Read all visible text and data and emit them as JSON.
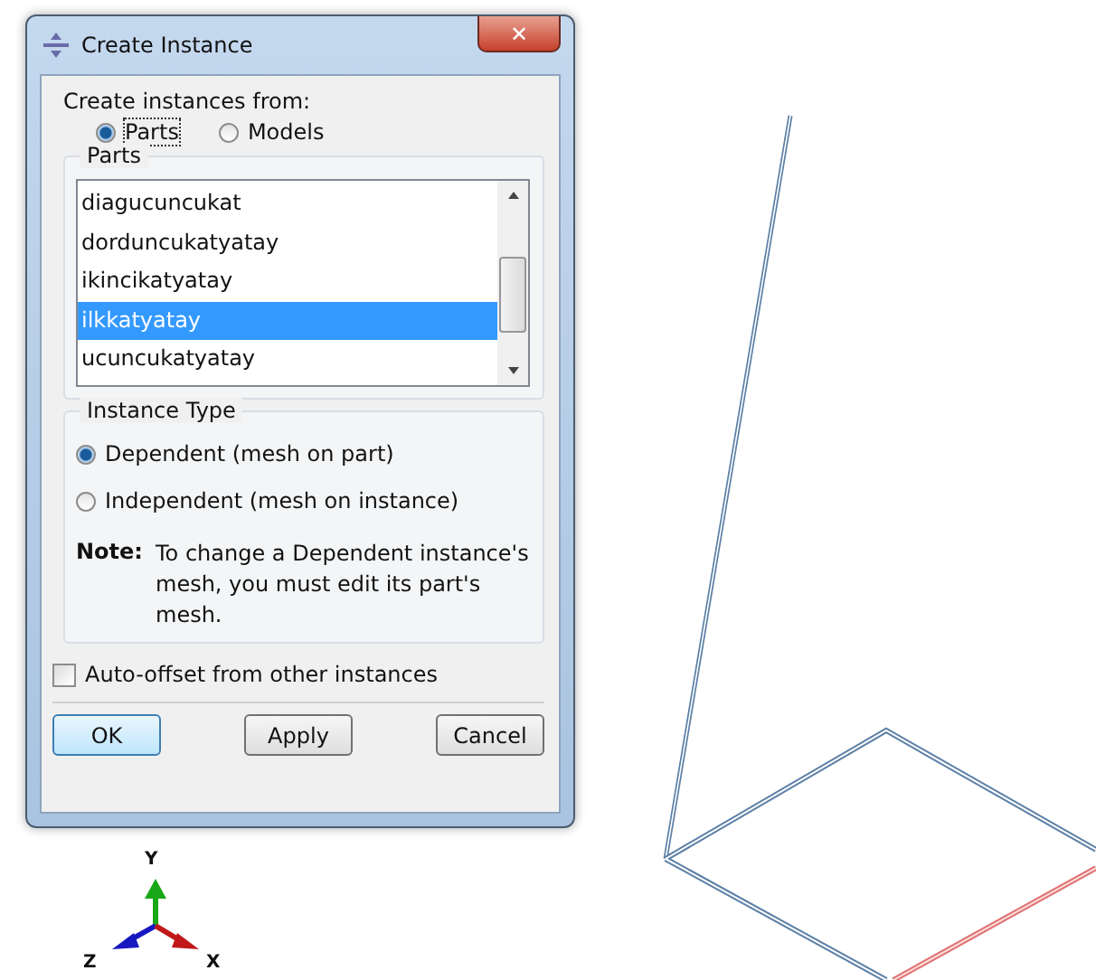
{
  "window": {
    "title": "Create Instance",
    "close": "✕"
  },
  "source": {
    "label": "Create instances from:",
    "options": [
      {
        "label": "Parts",
        "selected": true
      },
      {
        "label": "Models",
        "selected": false
      }
    ]
  },
  "parts": {
    "title": "Parts",
    "items": [
      {
        "label": "diagucuncukat",
        "selected": false
      },
      {
        "label": "dorduncukatyatay",
        "selected": false
      },
      {
        "label": "ikincikatyatay",
        "selected": false
      },
      {
        "label": "ilkkatyatay",
        "selected": true
      },
      {
        "label": "ucuncukatyatay",
        "selected": false
      }
    ]
  },
  "instance_type": {
    "title": "Instance Type",
    "options": [
      {
        "label": "Dependent (mesh on part)",
        "selected": true
      },
      {
        "label": "Independent (mesh on instance)",
        "selected": false
      }
    ],
    "note_label": "Note:",
    "note": "To change a Dependent instance's mesh, you must edit its part's mesh."
  },
  "auto_offset": {
    "label": "Auto-offset from other instances",
    "checked": false
  },
  "buttons": [
    {
      "label": "OK",
      "default": true
    },
    {
      "label": "Apply",
      "default": false
    },
    {
      "label": "Cancel",
      "default": false
    }
  ],
  "triad": {
    "y": "Y",
    "z": "Z",
    "x": "X"
  }
}
